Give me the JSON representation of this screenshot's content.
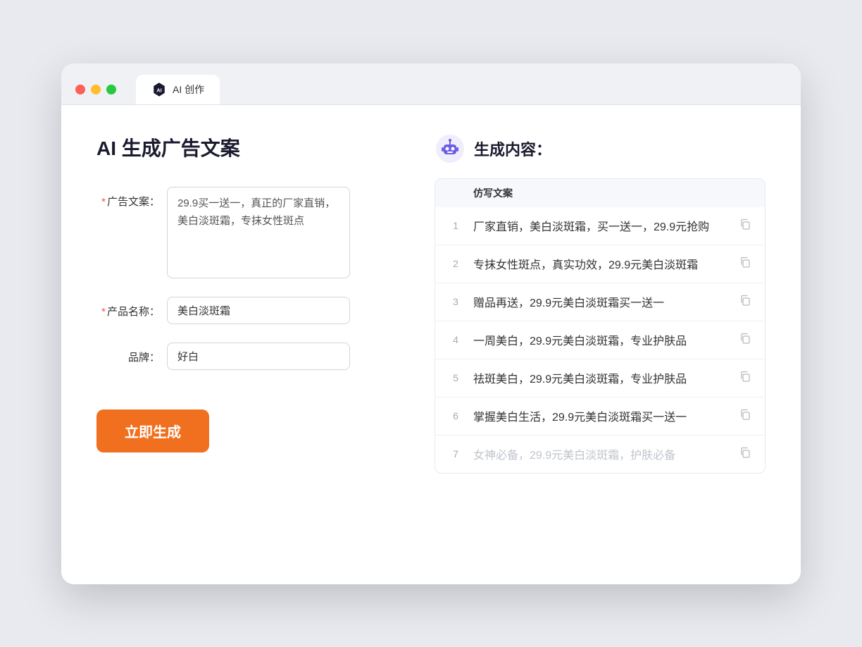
{
  "browser": {
    "tab_label": "AI 创作"
  },
  "page": {
    "title": "AI 生成广告文案",
    "form": {
      "ad_copy_label": "广告文案：",
      "ad_copy_required": true,
      "ad_copy_value": "29.9买一送一，真正的厂家直销，美白淡斑霜，专抹女性斑点",
      "product_name_label": "产品名称：",
      "product_name_required": true,
      "product_name_value": "美白淡斑霜",
      "brand_label": "品牌：",
      "brand_required": false,
      "brand_value": "好白",
      "generate_btn": "立即生成"
    },
    "result": {
      "header_title": "生成内容：",
      "column_label": "仿写文案",
      "items": [
        {
          "num": "1",
          "text": "厂家直销，美白淡斑霜，买一送一，29.9元抢购",
          "muted": false
        },
        {
          "num": "2",
          "text": "专抹女性斑点，真实功效，29.9元美白淡斑霜",
          "muted": false
        },
        {
          "num": "3",
          "text": "赠品再送，29.9元美白淡斑霜买一送一",
          "muted": false
        },
        {
          "num": "4",
          "text": "一周美白，29.9元美白淡斑霜，专业护肤品",
          "muted": false
        },
        {
          "num": "5",
          "text": "祛斑美白，29.9元美白淡斑霜，专业护肤品",
          "muted": false
        },
        {
          "num": "6",
          "text": "掌握美白生活，29.9元美白淡斑霜买一送一",
          "muted": false
        },
        {
          "num": "7",
          "text": "女神必备，29.9元美白淡斑霜，护肤必备",
          "muted": true
        }
      ]
    }
  }
}
